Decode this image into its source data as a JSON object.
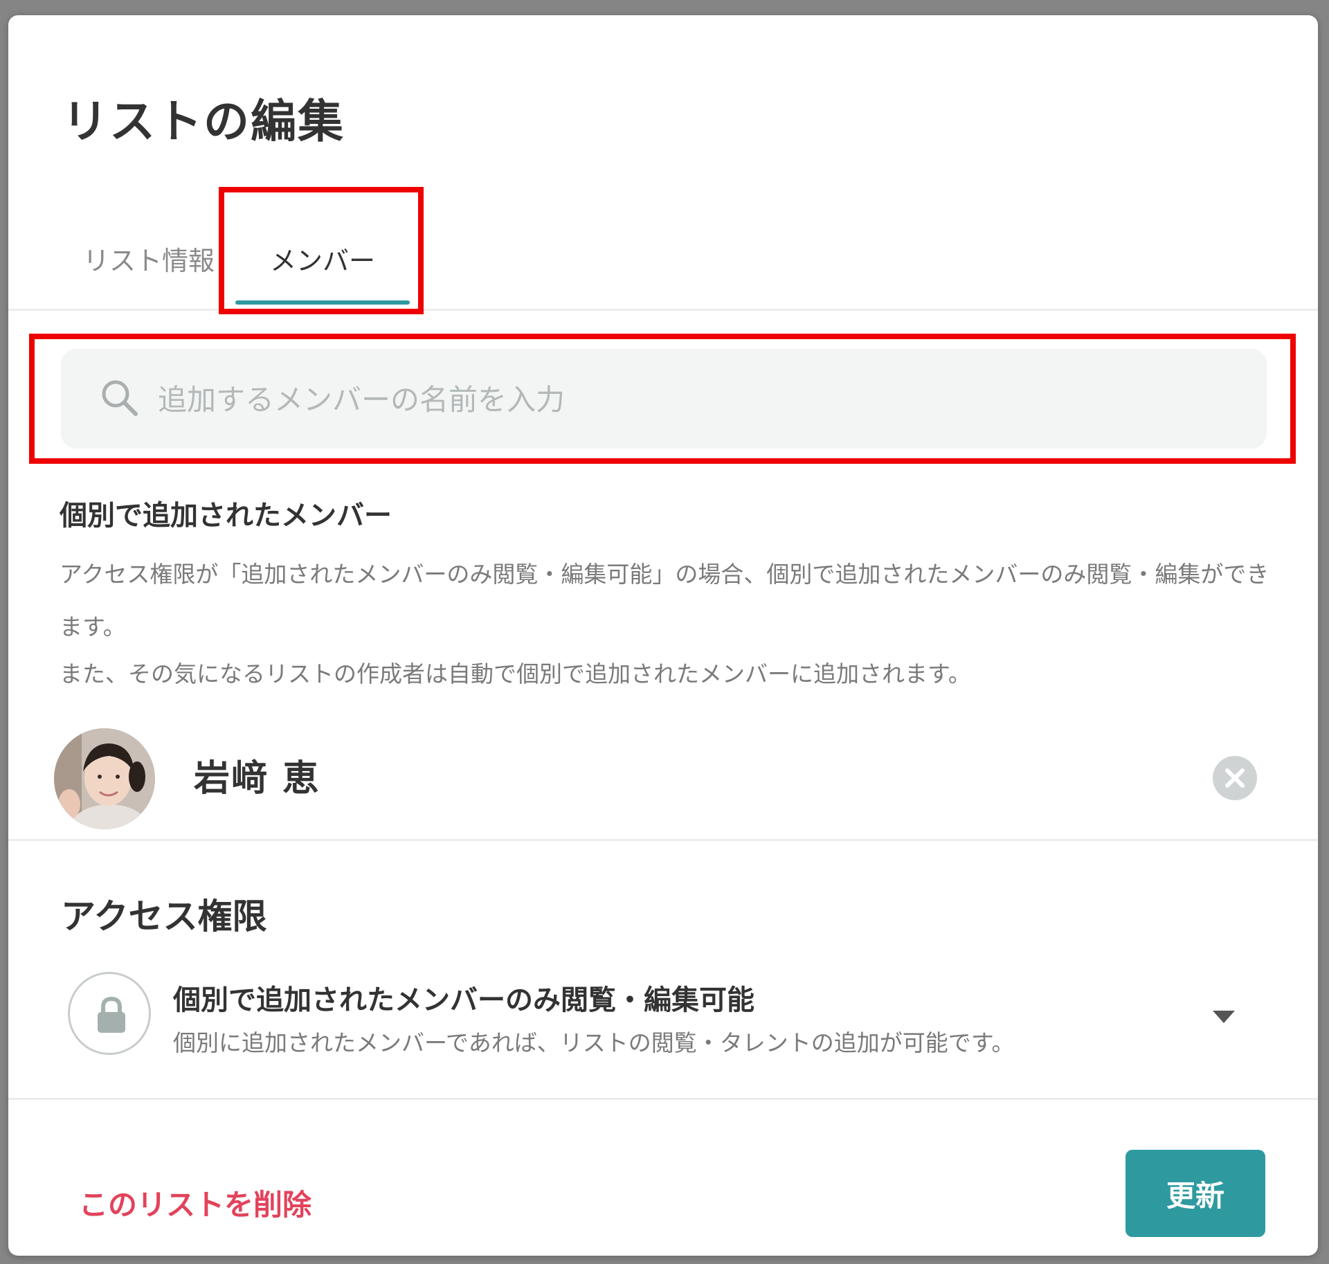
{
  "modal": {
    "title": "リストの編集"
  },
  "tabs": [
    {
      "label": "リスト情報",
      "active": false
    },
    {
      "label": "メンバー",
      "active": true
    }
  ],
  "search": {
    "placeholder": "追加するメンバーの名前を入力",
    "value": ""
  },
  "individual_members": {
    "heading": "個別で追加されたメンバー",
    "description_1": "アクセス権限が「追加されたメンバーのみ閲覧・編集可能」の場合、個別で追加されたメンバーのみ閲覧・編集ができます。",
    "description_2": "また、その気になるリストの作成者は自動で個別で追加されたメンバーに追加されます。",
    "members": [
      {
        "name": "岩﨑 恵"
      }
    ]
  },
  "access": {
    "heading": "アクセス権限",
    "selected_title": "個別で追加されたメンバーのみ閲覧・編集可能",
    "selected_description": "個別に追加されたメンバーであれば、リストの閲覧・タレントの追加が可能です。"
  },
  "footer": {
    "delete_label": "このリストを削除",
    "update_label": "更新"
  },
  "colors": {
    "accent": "#2e9aa0",
    "danger": "#e2435b",
    "highlight": "#ee0000"
  },
  "icons": {
    "search": "search-icon",
    "remove": "close-circle-icon",
    "lock": "lock-icon",
    "dropdown": "chevron-down-icon"
  }
}
